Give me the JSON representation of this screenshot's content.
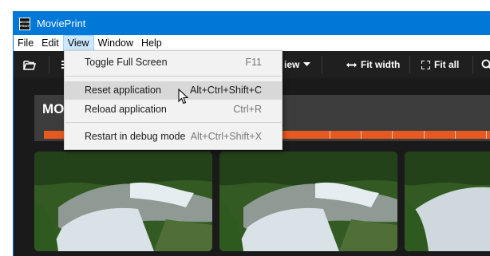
{
  "window": {
    "title": "MoviePrint",
    "icon_text": "MOVIE PRINT"
  },
  "menubar": {
    "items": [
      "File",
      "Edit",
      "View",
      "Window",
      "Help"
    ],
    "active": "View"
  },
  "toolbar": {
    "partial_label": "iew",
    "fit_width": "Fit width",
    "fit_all": "Fit all"
  },
  "content": {
    "header_partial": "MOV"
  },
  "view_menu": {
    "items": [
      {
        "label": "Toggle Full Screen",
        "shortcut": "F11"
      },
      {
        "label": "Reset application",
        "shortcut": "Alt+Ctrl+Shift+C",
        "highlighted": true
      },
      {
        "label": "Reload application",
        "shortcut": "Ctrl+R"
      },
      {
        "label": "Restart in debug mode",
        "shortcut": "Alt+Ctrl+Shift+X"
      }
    ]
  },
  "colors": {
    "titlebar": "#0078d7",
    "timeline": "#e8591f",
    "toolbar_bg": "#1f1f1f"
  },
  "icons": [
    "app-icon",
    "folder-open-icon",
    "grid-icon",
    "caret-down-icon",
    "fit-width-icon",
    "fit-all-icon",
    "zoom-icon",
    "mouse-cursor-icon"
  ]
}
